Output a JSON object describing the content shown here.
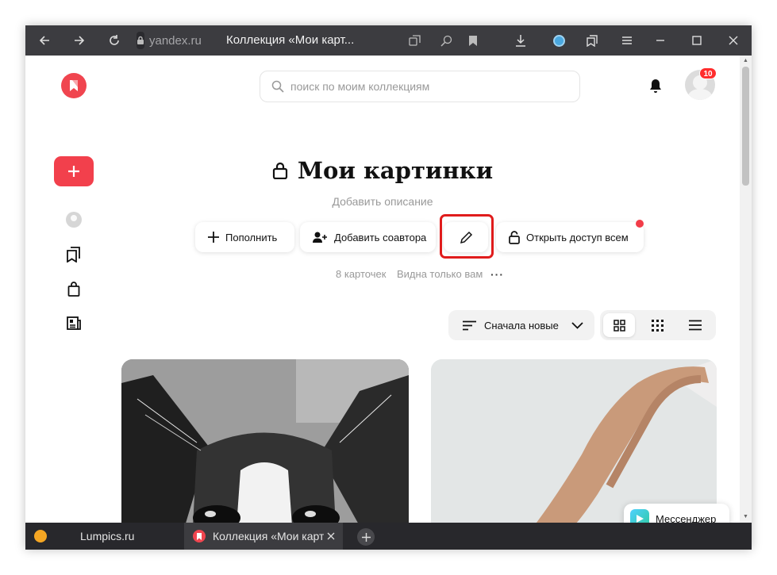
{
  "browser": {
    "domain": "yandex.ru",
    "tab_title": "Коллекция «Мои карт..."
  },
  "search": {
    "placeholder": "поиск по моим коллекциям"
  },
  "notifications_badge": "10",
  "collection": {
    "title": "Мои картинки",
    "description_placeholder": "Добавить описание",
    "cards_count": "8 карточек",
    "visibility": "Видна только вам"
  },
  "actions": {
    "add": "Пополнить",
    "add_coauthor": "Добавить соавтора",
    "open_access": "Открыть доступ всем"
  },
  "sort": {
    "selected": "Сначала новые"
  },
  "messenger_label": "Мессенджер",
  "bottom_tabs": [
    {
      "label": "Lumpics.ru",
      "favicon_color": "#f5a623"
    },
    {
      "label": "Коллекция «Мои карти",
      "favicon_color": "#f0454f"
    }
  ],
  "colors": {
    "accent": "#f0454f",
    "highlight": "#e01c1c"
  }
}
